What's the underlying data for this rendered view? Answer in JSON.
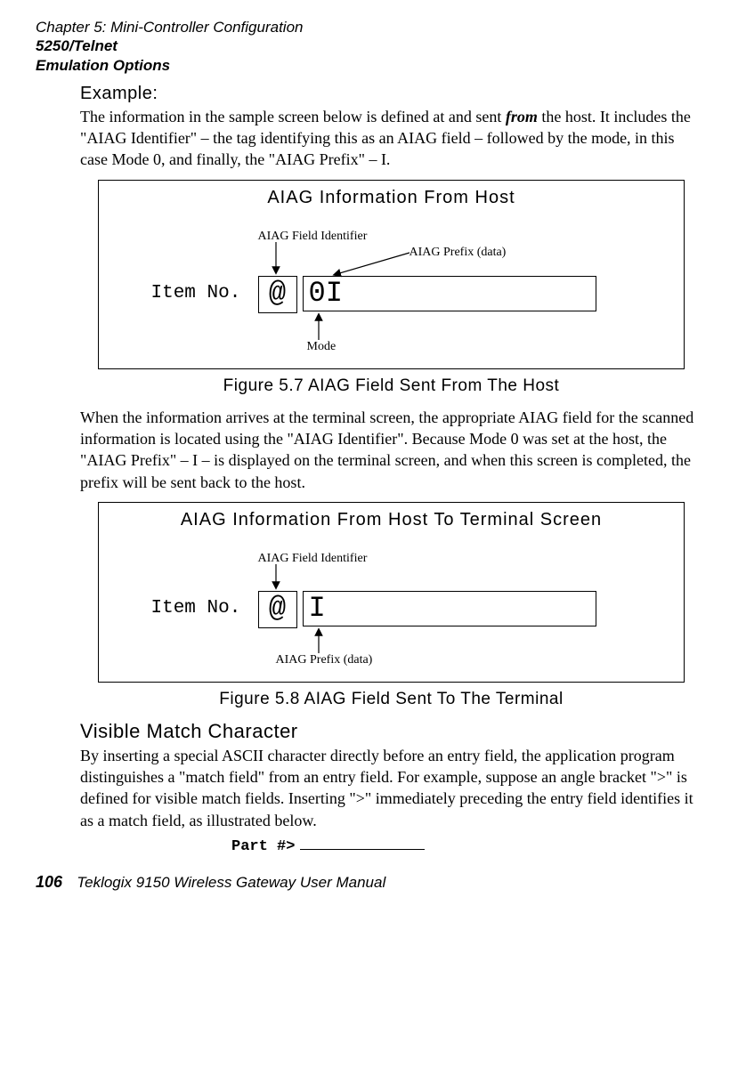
{
  "header": {
    "chapter": "Chapter 5:  Mini-Controller Configuration",
    "line2": "5250/Telnet",
    "line3": "Emulation Options"
  },
  "example_label": "Example:",
  "para1_a": "The information in the sample screen below is defined at and sent ",
  "para1_em": "from",
  "para1_b": " the host. It includes the \"AIAG Identifier\" – the tag identifying this as an AIAG field – followed by the mode, in this case Mode 0, and finally, the \"AIAG Prefix\" – I.",
  "fig1": {
    "title": "AIAG Information From Host",
    "anno_ident": "AIAG Field Identifier",
    "anno_prefix": "AIAG Prefix (data)",
    "anno_mode": "Mode",
    "item_label": "Item No.",
    "at": "@",
    "data": "0I",
    "caption": "Figure 5.7 AIAG Field Sent From The Host"
  },
  "para2": "When the information arrives at the terminal screen, the appropriate AIAG field for the scanned information is located using the \"AIAG Identifier\". Because Mode 0 was set at the host, the \"AIAG Prefix\" – I – is displayed on the terminal screen, and when this screen is completed, the prefix will be sent back to the host.",
  "fig2": {
    "title": "AIAG Information From Host To Terminal Screen",
    "anno_ident": "AIAG Field Identifier",
    "anno_prefix": "AIAG Prefix (data)",
    "item_label": "Item No.",
    "at": "@",
    "data": "I",
    "caption": "Figure 5.8 AIAG Field Sent To The Terminal"
  },
  "visible_match_heading": "Visible Match Character",
  "para3": "By inserting a special ASCII character directly before an entry field, the application program distinguishes a \"match field\" from an entry field. For example, suppose an angle bracket \">\" is defined for visible match fields. Inserting \">\" immediately preceding the entry field identifies it as a match field, as illustrated below.",
  "part_label": "Part #>",
  "footer": {
    "page": "106",
    "book": "Teklogix 9150 Wireless Gateway User Manual"
  }
}
